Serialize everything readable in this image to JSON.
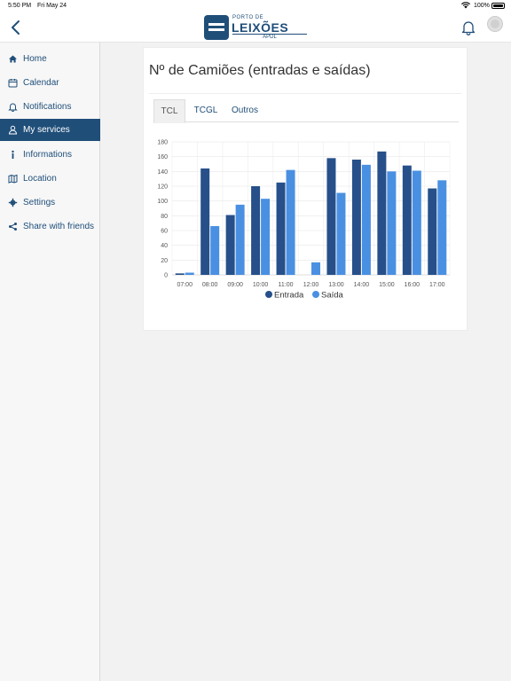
{
  "status_bar": {
    "time": "5:50 PM",
    "date": "Fri May 24",
    "battery": "100%"
  },
  "header": {
    "logo": {
      "top": "PORTO DE",
      "main": "LEIXÕES",
      "sub": "APDL"
    }
  },
  "sidebar": {
    "items": [
      {
        "label": "Home",
        "icon": "home-icon",
        "active": false
      },
      {
        "label": "Calendar",
        "icon": "calendar-icon",
        "active": false
      },
      {
        "label": "Notifications",
        "icon": "bell-icon",
        "active": false
      },
      {
        "label": "My services",
        "icon": "user-icon",
        "active": true
      },
      {
        "label": "Informations",
        "icon": "info-icon",
        "active": false
      },
      {
        "label": "Location",
        "icon": "map-icon",
        "active": false
      },
      {
        "label": "Settings",
        "icon": "gear-icon",
        "active": false
      },
      {
        "label": "Share with friends",
        "icon": "share-icon",
        "active": false
      }
    ]
  },
  "main": {
    "title": "Nº de Camiões (entradas e saídas)",
    "tabs": [
      {
        "label": "TCL",
        "active": true
      },
      {
        "label": "TCGL",
        "active": false
      },
      {
        "label": "Outros",
        "active": false
      }
    ]
  },
  "colors": {
    "brand": "#1f4e79",
    "entrada": "#27508a",
    "saida": "#4a90e2"
  },
  "chart_data": {
    "type": "bar",
    "categories": [
      "07:00",
      "08:00",
      "09:00",
      "10:00",
      "11:00",
      "12:00",
      "13:00",
      "14:00",
      "15:00",
      "16:00",
      "17:00"
    ],
    "series": [
      {
        "name": "Entrada",
        "values": [
          2,
          144,
          81,
          120,
          125,
          0,
          158,
          156,
          167,
          148,
          117
        ]
      },
      {
        "name": "Saída",
        "values": [
          3,
          66,
          95,
          103,
          142,
          17,
          111,
          149,
          140,
          141,
          128
        ]
      }
    ],
    "yticks": [
      0,
      20,
      40,
      60,
      80,
      100,
      120,
      140,
      160,
      180
    ],
    "ylim": [
      0,
      180
    ],
    "grid": true,
    "legend": "bottom"
  }
}
